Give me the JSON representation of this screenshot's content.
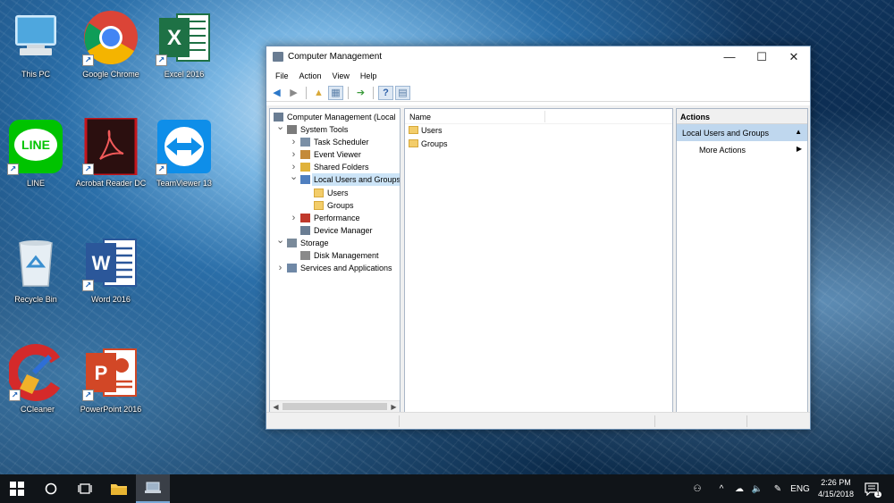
{
  "desktop": {
    "icons": [
      {
        "label": "This PC",
        "icon": "this-pc-icon"
      },
      {
        "label": "Google Chrome",
        "icon": "chrome-icon"
      },
      {
        "label": "Excel 2016",
        "icon": "excel-icon"
      },
      {
        "label": "LINE",
        "icon": "line-icon"
      },
      {
        "label": "Acrobat Reader DC",
        "icon": "acrobat-icon"
      },
      {
        "label": "TeamViewer 13",
        "icon": "teamviewer-icon"
      },
      {
        "label": "Recycle Bin",
        "icon": "recycle-bin-icon"
      },
      {
        "label": "Word 2016",
        "icon": "word-icon"
      },
      {
        "label": "CCleaner",
        "icon": "ccleaner-icon"
      },
      {
        "label": "PowerPoint 2016",
        "icon": "powerpoint-icon"
      }
    ]
  },
  "window": {
    "title": "Computer Management",
    "controls": {
      "minimize": "—",
      "maximize": "☐",
      "close": "✕"
    },
    "menu": [
      "File",
      "Action",
      "View",
      "Help"
    ],
    "tree": [
      {
        "label": "Computer Management (Local",
        "level": 0,
        "expander": "",
        "icon": "computer-management-icon"
      },
      {
        "label": "System Tools",
        "level": 1,
        "expander": "v",
        "icon": "tools-icon"
      },
      {
        "label": "Task Scheduler",
        "level": 2,
        "expander": ">",
        "icon": "clock-icon"
      },
      {
        "label": "Event Viewer",
        "level": 2,
        "expander": ">",
        "icon": "event-viewer-icon"
      },
      {
        "label": "Shared Folders",
        "level": 2,
        "expander": ">",
        "icon": "shared-folder-icon"
      },
      {
        "label": "Local Users and Groups",
        "level": 2,
        "expander": "v",
        "icon": "users-icon",
        "selected": true
      },
      {
        "label": "Users",
        "level": 3,
        "expander": "",
        "icon": "folder-icon"
      },
      {
        "label": "Groups",
        "level": 3,
        "expander": "",
        "icon": "folder-icon"
      },
      {
        "label": "Performance",
        "level": 2,
        "expander": ">",
        "icon": "performance-icon"
      },
      {
        "label": "Device Manager",
        "level": 2,
        "expander": "",
        "icon": "device-manager-icon"
      },
      {
        "label": "Storage",
        "level": 1,
        "expander": "v",
        "icon": "storage-icon"
      },
      {
        "label": "Disk Management",
        "level": 2,
        "expander": "",
        "icon": "disk-icon"
      },
      {
        "label": "Services and Applications",
        "level": 1,
        "expander": ">",
        "icon": "services-icon"
      }
    ],
    "content": {
      "column_header": "Name",
      "items": [
        "Users",
        "Groups"
      ]
    },
    "actions": {
      "header": "Actions",
      "section": "Local Users and Groups",
      "items": [
        "More Actions"
      ]
    }
  },
  "taskbar": {
    "tray": {
      "language": "ENG",
      "time": "2:26 PM",
      "date": "4/15/2018",
      "notification_count": "1"
    }
  }
}
